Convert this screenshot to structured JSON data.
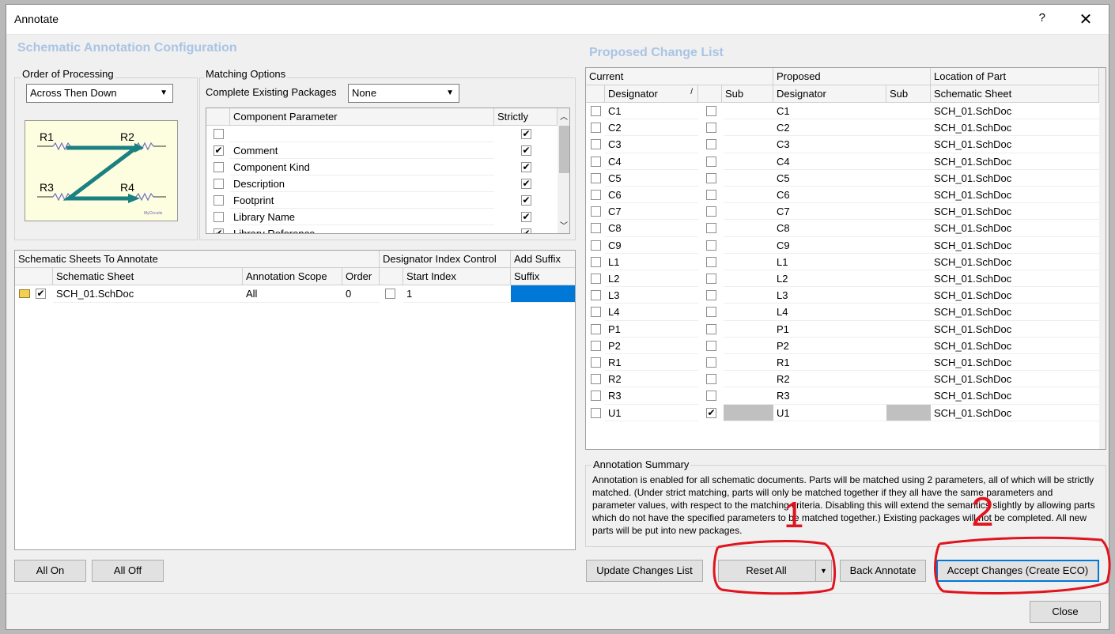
{
  "window": {
    "title": "Annotate",
    "help": "?",
    "close": "✕"
  },
  "left": {
    "section_title": "Schematic Annotation Configuration",
    "order_label": "Order of Processing",
    "order_value": "Across Then Down",
    "diagram": {
      "r1": "R1",
      "r2": "R2",
      "r3": "R3",
      "r4": "R4"
    },
    "matching_label": "Matching Options",
    "complete_label": "Complete Existing Packages",
    "complete_value": "None",
    "param_headers": {
      "param": "Component Parameter",
      "strictly": "Strictly"
    },
    "params": [
      {
        "name": "",
        "checked": false,
        "strict": true
      },
      {
        "name": "Comment",
        "checked": true,
        "strict": true
      },
      {
        "name": "Component Kind",
        "checked": false,
        "strict": true
      },
      {
        "name": "Description",
        "checked": false,
        "strict": true
      },
      {
        "name": "Footprint",
        "checked": false,
        "strict": true
      },
      {
        "name": "Library Name",
        "checked": false,
        "strict": true
      },
      {
        "name": "Library Reference",
        "checked": true,
        "strict": true
      }
    ],
    "sheets": {
      "group_headers": {
        "sheets": "Schematic Sheets To Annotate",
        "index": "Designator Index Control",
        "suffix": "Add Suffix"
      },
      "headers": {
        "sheet": "Schematic Sheet",
        "scope": "Annotation Scope",
        "order": "Order",
        "start": "Start Index",
        "suffix": "Suffix"
      },
      "rows": [
        {
          "checked": true,
          "sheet": "SCH_01.SchDoc",
          "scope": "All",
          "order": "0",
          "start_checked": false,
          "start": "1",
          "suffix": ""
        }
      ]
    },
    "all_on": "All On",
    "all_off": "All Off"
  },
  "right": {
    "section_title": "Proposed Change List",
    "group_headers": {
      "current": "Current",
      "proposed": "Proposed",
      "location": "Location of Part"
    },
    "headers": {
      "designator": "Designator",
      "sub": "Sub",
      "p_designator": "Designator",
      "p_sub": "Sub",
      "sheet": "Schematic Sheet"
    },
    "rows": [
      {
        "cur": "C1",
        "sub_checked": false,
        "prop": "C1",
        "sheet": "SCH_01.SchDoc"
      },
      {
        "cur": "C2",
        "sub_checked": false,
        "prop": "C2",
        "sheet": "SCH_01.SchDoc"
      },
      {
        "cur": "C3",
        "sub_checked": false,
        "prop": "C3",
        "sheet": "SCH_01.SchDoc"
      },
      {
        "cur": "C4",
        "sub_checked": false,
        "prop": "C4",
        "sheet": "SCH_01.SchDoc"
      },
      {
        "cur": "C5",
        "sub_checked": false,
        "prop": "C5",
        "sheet": "SCH_01.SchDoc"
      },
      {
        "cur": "C6",
        "sub_checked": false,
        "prop": "C6",
        "sheet": "SCH_01.SchDoc"
      },
      {
        "cur": "C7",
        "sub_checked": false,
        "prop": "C7",
        "sheet": "SCH_01.SchDoc"
      },
      {
        "cur": "C8",
        "sub_checked": false,
        "prop": "C8",
        "sheet": "SCH_01.SchDoc"
      },
      {
        "cur": "C9",
        "sub_checked": false,
        "prop": "C9",
        "sheet": "SCH_01.SchDoc"
      },
      {
        "cur": "L1",
        "sub_checked": false,
        "prop": "L1",
        "sheet": "SCH_01.SchDoc"
      },
      {
        "cur": "L2",
        "sub_checked": false,
        "prop": "L2",
        "sheet": "SCH_01.SchDoc"
      },
      {
        "cur": "L3",
        "sub_checked": false,
        "prop": "L3",
        "sheet": "SCH_01.SchDoc"
      },
      {
        "cur": "L4",
        "sub_checked": false,
        "prop": "L4",
        "sheet": "SCH_01.SchDoc"
      },
      {
        "cur": "P1",
        "sub_checked": false,
        "prop": "P1",
        "sheet": "SCH_01.SchDoc"
      },
      {
        "cur": "P2",
        "sub_checked": false,
        "prop": "P2",
        "sheet": "SCH_01.SchDoc"
      },
      {
        "cur": "R1",
        "sub_checked": false,
        "prop": "R1",
        "sheet": "SCH_01.SchDoc"
      },
      {
        "cur": "R2",
        "sub_checked": false,
        "prop": "R2",
        "sheet": "SCH_01.SchDoc"
      },
      {
        "cur": "R3",
        "sub_checked": false,
        "prop": "R3",
        "sheet": "SCH_01.SchDoc"
      },
      {
        "cur": "U1",
        "sub_checked": true,
        "prop": "U1",
        "sheet": "SCH_01.SchDoc"
      }
    ],
    "summary_label": "Annotation Summary",
    "summary_text": "Annotation is enabled for all schematic documents. Parts will be matched using 2 parameters, all of which will be strictly matched. (Under strict matching, parts will only be matched together if they all have the same parameters and parameter values, with respect to the matching criteria. Disabling this will extend the semantics slightly by allowing parts which do not have the specified parameters to be matched together.) Existing packages will not be completed. All new parts will be put into new packages.",
    "update_btn": "Update Changes List",
    "reset_btn": "Reset All",
    "back_btn": "Back Annotate",
    "accept_btn": "Accept Changes (Create ECO)"
  },
  "close_btn": "Close",
  "annotations": {
    "one": "1",
    "two": "2"
  },
  "colors": {
    "accent": "#0078d7",
    "title": "#a9c4e4",
    "annotation": "#e0141e",
    "teal": "#1a8080"
  }
}
